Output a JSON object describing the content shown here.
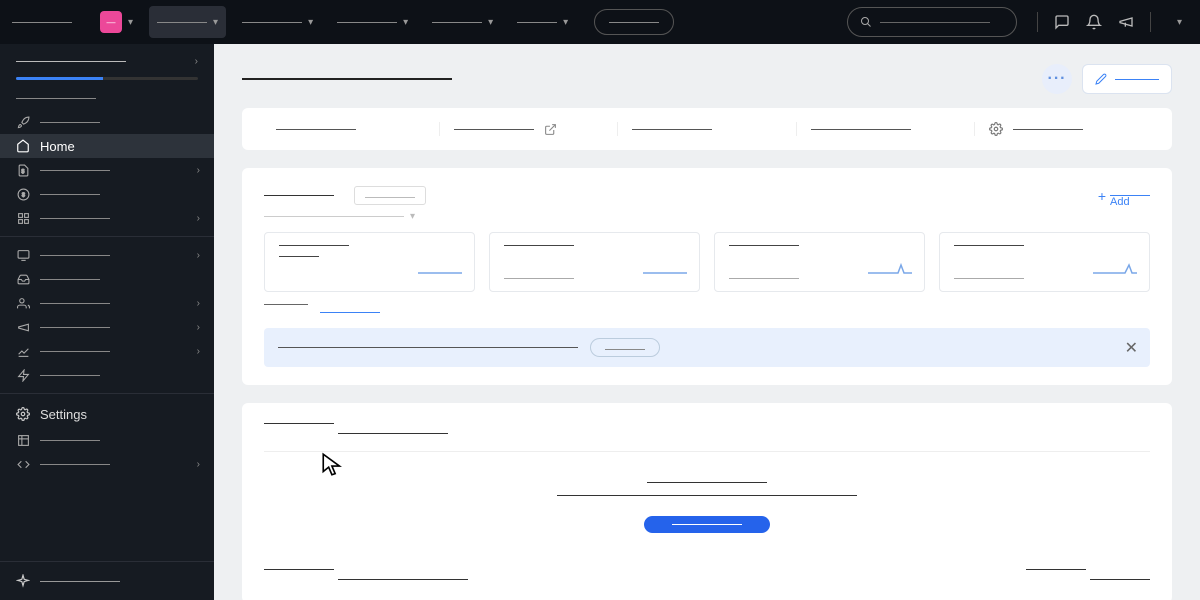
{
  "topbar": {
    "nav_items": [
      "",
      "",
      "",
      ""
    ],
    "search_placeholder": ""
  },
  "sidebar": {
    "home_label": "Home",
    "settings_label": "Settings"
  },
  "stats": {
    "add_label": "Add"
  },
  "banner": {
    "button_label": ""
  },
  "cta": {
    "button_label": ""
  }
}
